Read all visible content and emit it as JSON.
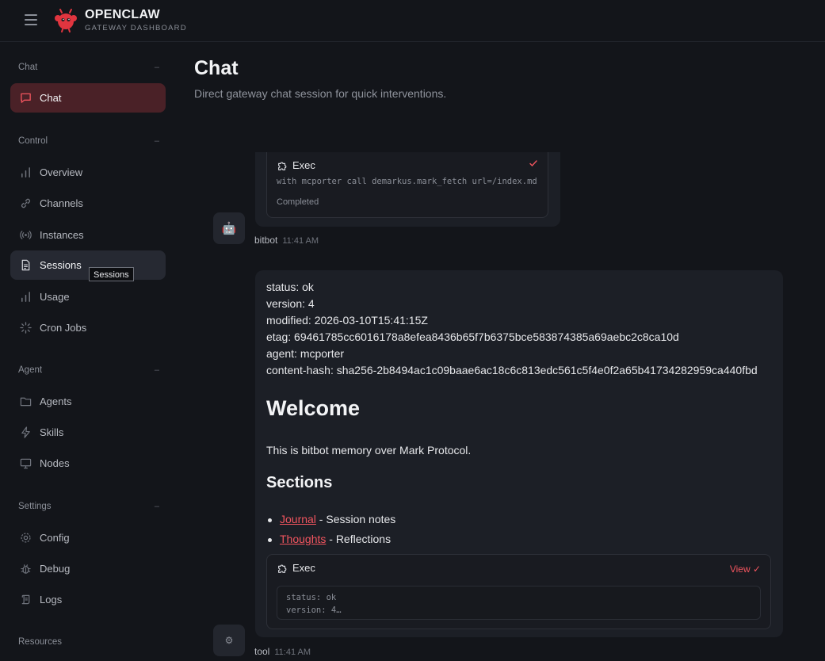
{
  "brand": {
    "name": "OPENCLAW",
    "subtitle": "GATEWAY DASHBOARD"
  },
  "sidebar": {
    "sections": [
      {
        "title": "Chat",
        "collapse": "–",
        "items": [
          {
            "label": "Chat",
            "icon": "message-square-icon"
          }
        ]
      },
      {
        "title": "Control",
        "collapse": "–",
        "items": [
          {
            "label": "Overview",
            "icon": "bar-chart-icon"
          },
          {
            "label": "Channels",
            "icon": "link-icon"
          },
          {
            "label": "Instances",
            "icon": "radio-icon"
          },
          {
            "label": "Sessions",
            "icon": "file-text-icon"
          },
          {
            "label": "Usage",
            "icon": "bar-chart-icon"
          },
          {
            "label": "Cron Jobs",
            "icon": "loader-icon"
          }
        ]
      },
      {
        "title": "Agent",
        "collapse": "–",
        "items": [
          {
            "label": "Agents",
            "icon": "folder-icon"
          },
          {
            "label": "Skills",
            "icon": "zap-icon"
          },
          {
            "label": "Nodes",
            "icon": "monitor-icon"
          }
        ]
      },
      {
        "title": "Settings",
        "collapse": "–",
        "items": [
          {
            "label": "Config",
            "icon": "settings-icon"
          },
          {
            "label": "Debug",
            "icon": "bug-icon"
          },
          {
            "label": "Logs",
            "icon": "scroll-icon"
          }
        ]
      },
      {
        "title": "Resources"
      }
    ],
    "tooltip": "Sessions",
    "active_item": "Chat",
    "hovered_item": "Sessions"
  },
  "page": {
    "title": "Chat",
    "subtitle": "Direct gateway chat session for quick interventions."
  },
  "messages": {
    "first": {
      "tool": {
        "title": "Exec",
        "command": "with mcporter call demarkus.mark_fetch url=/index.md",
        "status": "Completed"
      },
      "sender": "bitbot",
      "time": "11:41 AM",
      "avatar": "🤖"
    },
    "second": {
      "lines": [
        "status: ok",
        "version: 4",
        "modified: 2026-03-10T15:41:15Z",
        "etag: 69461785cc6016178a8efea8436b65f7b6375bce583874385a69aebc2c8ca10d",
        "agent: mcporter",
        "content-hash: sha256-2b8494ac1c09baae6ac18c6c813edc561c5f4e0f2a65b41734282959ca440fbd"
      ],
      "heading": "Welcome",
      "intro": "This is bitbot memory over Mark Protocol.",
      "subheading": "Sections",
      "bullets": [
        {
          "link": "Journal",
          "text": " - Session notes"
        },
        {
          "link": "Thoughts",
          "text": " - Reflections"
        }
      ],
      "tool": {
        "title": "Exec",
        "view_label": "View ✓",
        "output_lines": [
          "status: ok",
          "version: 4…"
        ]
      },
      "sender": "tool",
      "time": "11:41 AM",
      "avatar": "⚙"
    }
  },
  "colors": {
    "accent": "#f2555f",
    "active_bg": "#4a2127",
    "bg": "#13151a",
    "card": "#1c1f26"
  }
}
